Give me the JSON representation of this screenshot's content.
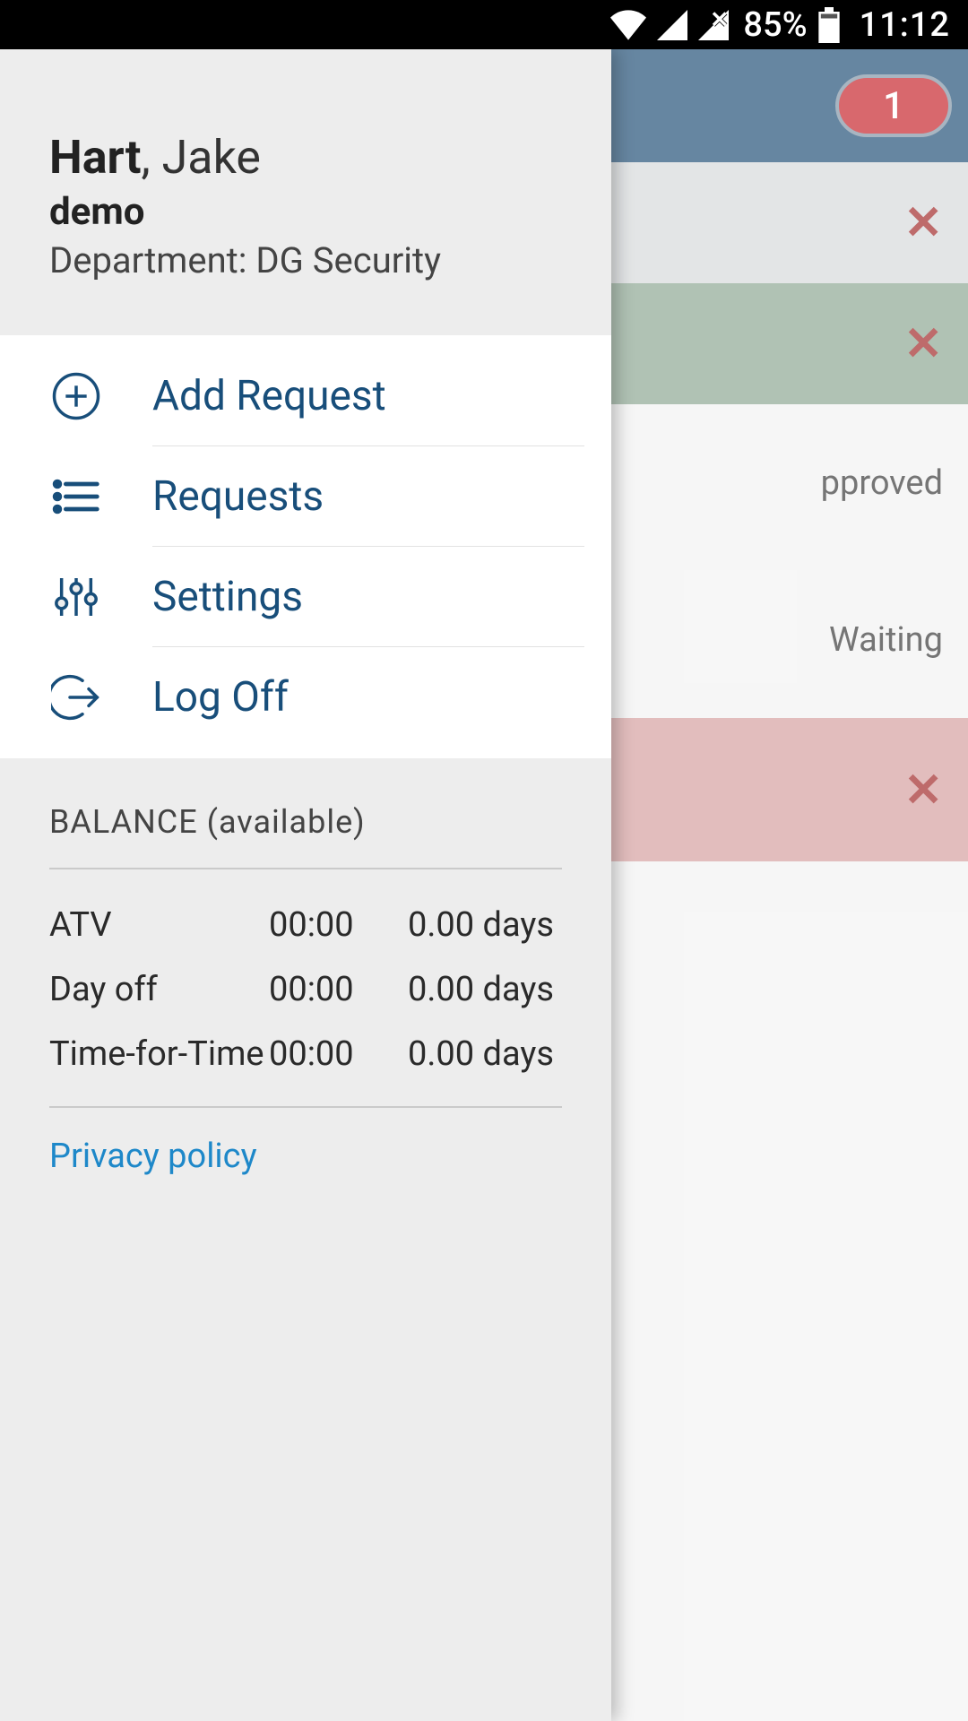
{
  "status": {
    "battery": "85%",
    "time": "11:12"
  },
  "background": {
    "badge": "1",
    "row3_text": "pproved",
    "row4_text": "Waiting"
  },
  "profile": {
    "surname": "Hart",
    "given_sep": ", ",
    "given": "Jake",
    "subtitle": "demo",
    "dept_label": "Department: ",
    "dept_value": "DG Security"
  },
  "menu": {
    "add_request": "Add Request",
    "requests": "Requests",
    "settings": "Settings",
    "logoff": "Log Off"
  },
  "balance": {
    "title": "BALANCE (available)",
    "rows": [
      {
        "label": "ATV",
        "time": "00:00",
        "days": "0.00  days"
      },
      {
        "label": "Day off",
        "time": "00:00",
        "days": "0.00  days"
      },
      {
        "label": "Time-for-Time",
        "time": "00:00",
        "days": "0.00  days"
      }
    ],
    "privacy": "Privacy policy"
  }
}
